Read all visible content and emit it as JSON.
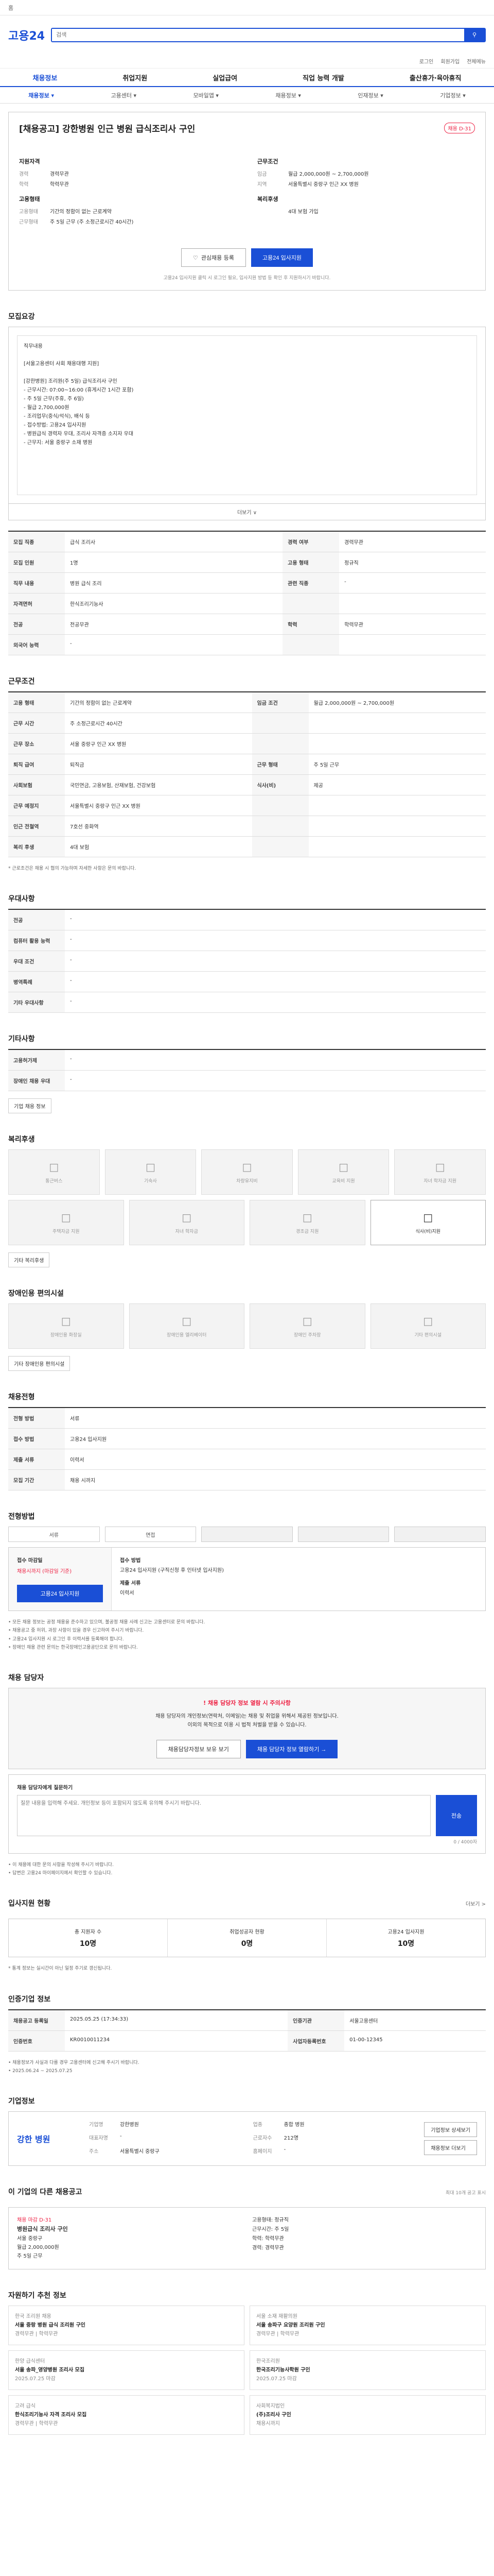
{
  "topbar": {
    "home": "홈"
  },
  "header": {
    "logo": "고용24",
    "search_placeholder": "검색"
  },
  "util": [
    "로그인",
    "회원가입",
    "전체메뉴"
  ],
  "gnb": [
    "채용정보",
    "취업지원",
    "실업급여",
    "직업 능력 개발",
    "출산휴가·육아휴직"
  ],
  "subnav": [
    "채용정보 ▾",
    "고용센터 ▾",
    "모바일앱 ▾",
    "채용정보 ▾",
    "인재정보 ▾",
    "기업정보 ▾"
  ],
  "job": {
    "title": "[채용공고] 강한병원 인근 병원 급식조리사 구인",
    "badge": "채용 D-31",
    "org_head": "지원자격",
    "org_rows": [
      [
        "경력",
        "경력무관"
      ],
      [
        "학력",
        "학력무관"
      ]
    ],
    "cond_head": "근무조건",
    "cond_rows": [
      [
        "임금",
        "월급 2,000,000원 ~ 2,700,000원"
      ],
      [
        "지역",
        "서울특별시 중랑구 인근 XX 병원"
      ]
    ],
    "work_head": "고용형태",
    "work_rows": [
      [
        "고용형태",
        "기간의 정함이 없는 근로계약"
      ],
      [
        "근무형태",
        "주 5일 근무 (주 소정근로시간 40시간)"
      ]
    ],
    "extra_head": "복리후생",
    "extra_rows": [
      [
        "",
        "4대 보험 가입"
      ]
    ],
    "fav": "관심채용 등록",
    "apply": "고용24 입사지원",
    "note": "고용24 입사지원 클릭 시 로그인 필요, 입사지원 방법 등 확인 후 지원하시기 바랍니다."
  },
  "desc": {
    "title": "모집요강",
    "text": "직무내용\n\n[서울고용센터 사회 채용대행 지원]\n\n[강한병원] 조리원(주 5일) 급식조리사 구인\n- 근무시간: 07:00~16:00 (휴게시간 1시간 포함)\n- 주 5일 근무(주휴, 주 6일)\n- 월급 2,700,000원\n- 조리업무(중식/석식), 배식 등\n- 접수방법: 고용24 입사지원\n- 병원급식 경력자 우대, 조리사 자격증 소지자 우대\n- 근무지: 서울 중랑구 소재 병원",
    "more": "더보기 ∨"
  },
  "summary_table": [
    [
      "모집 직종",
      "급식 조리사",
      "경력 여부",
      "경력무관"
    ],
    [
      "모집 인원",
      "1명",
      "고용 형태",
      "정규직"
    ],
    [
      "직무 내용",
      "병원 급식 조리",
      "관련 직종",
      "-"
    ],
    [
      "자격면허",
      "한식조리기능사",
      "",
      ""
    ],
    [
      "전공",
      "전공무관",
      "학력",
      "학력무관"
    ],
    [
      "외국어 능력",
      "-",
      "",
      ""
    ]
  ],
  "cond": {
    "title": "근무조건",
    "rows": [
      [
        "고용 형태",
        "기간의 정함이 없는 근로계약",
        "임금 조건",
        "월급 2,000,000원 ~ 2,700,000원"
      ],
      [
        "근무 시간",
        "주 소정근로시간 40시간",
        "",
        ""
      ],
      [
        "근무 장소",
        "서울 중랑구 인근 XX 병원",
        "",
        ""
      ],
      [
        "퇴직 급여",
        "퇴직금",
        "근무 형태",
        "주 5일 근무"
      ],
      [
        "사회보험",
        "국민연금, 고용보험, 산재보험, 건강보험",
        "식사(비)",
        "제공"
      ],
      [
        "근무 예정지",
        "서울특별시 중랑구 인근 XX 병원",
        "",
        ""
      ],
      [
        "인근 전철역",
        "7호선 중화역",
        "",
        ""
      ],
      [
        "복리 후생",
        "4대 보험",
        "",
        ""
      ]
    ],
    "note": "* 근로조건은 채용 시 협의 가능하며 자세한 사항은 문의 바랍니다."
  },
  "pref": {
    "title": "우대사항",
    "rows": [
      [
        "전공",
        "-"
      ],
      [
        "컴퓨터 활용 능력",
        "-"
      ],
      [
        "우대 조건",
        "-"
      ],
      [
        "병역특례",
        "-"
      ],
      [
        "기타 우대사항",
        "-"
      ]
    ]
  },
  "etc": {
    "title": "기타사항",
    "rows": [
      [
        "고용허가제",
        "-"
      ],
      [
        "장애인 채용 우대",
        "-"
      ]
    ],
    "tag": "기업 채용 정보"
  },
  "welfare": {
    "title": "복리후생",
    "items": [
      "통근버스",
      "기숙사",
      "차량유지비",
      "교육비 지원",
      "자녀 학자금 지원",
      "주택자금 지원",
      "자녀 학자금",
      "경조금 지원",
      "식사(비)지원"
    ],
    "tag": "기타 복리후생"
  },
  "disabled": {
    "title": "장애인용 편의시설",
    "items": [
      "장애인용 화장실",
      "장애인용 엘리베이터",
      "장애인 주차장",
      "기타 편의시설"
    ],
    "tag": "기타 장애인용 편의시설"
  },
  "apply": {
    "title": "채용전형",
    "rows": [
      [
        "전형 방법",
        "서류"
      ],
      [
        "접수 방법",
        "고용24 입사지원"
      ],
      [
        "제출 서류",
        "이력서"
      ],
      [
        "모집 기간",
        "채용 시까지"
      ]
    ],
    "stage_title": "전형방법",
    "stages": [
      "서류",
      "면접",
      "",
      "",
      ""
    ],
    "left_head": "접수 마감일",
    "left_date": "채용시까지 (마감일 기준)",
    "left_btn": "고용24 입사지원",
    "right": [
      "접수 방법",
      "고용24 입사지원 (구직신청 후 인터넷 입사지원)",
      "제출 서류",
      "이력서"
    ],
    "bullets": [
      "• 모든 채용 정보는 공정 채용을 준수하고 있으며, 불공정 채용 사례 신고는 고용센터로 문의 바랍니다.",
      "• 채용공고 중 허위, 과장 사항이 있을 경우 신고하여 주시기 바랍니다.",
      "• 고용24 입사지원 시 로그인 후 이력서를 등록해야 합니다.",
      "• 장애인 채용 관련 문의는 한국장애인고용공단으로 문의 바랍니다."
    ]
  },
  "inquiry": {
    "title": "채용 담당자",
    "warn_head": "! 채용 담당자 정보 열람 시 주의사항",
    "warn_text": "채용 담당자의 개인정보(연락처, 이메일)는 채용 및 취업을 위해서 제공된 정보입니다.\n이외의 목적으로 이용 시 법적 처벌을 받을 수 있습니다.",
    "btn1": "채용담당자정보 보유 보기",
    "btn2": "채용 담당자 정보 열람하기 →",
    "q_head": "채용 담당자에게 질문하기",
    "q_placeholder": "질문 내용을 입력해 주세요. 개인정보 등이 포함되지 않도록 유의해 주시기 바랍니다.",
    "q_count": "0 / 4000자",
    "q_send": "전송",
    "q_notes": [
      "• 이 채용에 대한 문의 사항을 작성해 주시기 바랍니다.",
      "• 답변은 고용24 마이페이지에서 확인할 수 있습니다."
    ]
  },
  "stats": {
    "title": "입사지원 현황",
    "more": "더보기 >",
    "items": [
      [
        "총 지원자 수",
        "10명"
      ],
      [
        "취업성공자 현황",
        "0명"
      ],
      [
        "고용24 입사지원",
        "10명"
      ]
    ],
    "note": "* 통계 정보는 실시간이 아닌 일정 주기로 갱신됩니다."
  },
  "manage": {
    "title": "인증기업 정보",
    "rows": [
      [
        "채용공고 등록일",
        "2025.05.25 (17:34:33)",
        "인증기관",
        "서울고용센터"
      ],
      [
        "인증번호",
        "KR0010011234",
        "사업자등록번호",
        "01-00-12345"
      ]
    ],
    "notes": [
      "• 채용정보가 사실과 다를 경우 고용센터에 신고해 주시기 바랍니다.",
      "• 2025.06.24 ~ 2025.07.25"
    ]
  },
  "company": {
    "title": "기업정보",
    "logo": "강한 병원",
    "rows": [
      [
        "기업명",
        "강한병원"
      ],
      [
        "업종",
        "종합 병원"
      ],
      [
        "대표자명",
        "-"
      ],
      [
        "근로자수",
        "212명"
      ],
      [
        "주소",
        "서울특별시 중랑구"
      ],
      [
        "홈페이지",
        "-"
      ]
    ],
    "btn1": "기업정보 상세보기",
    "btn2": "채용정보 더보기"
  },
  "recommend": {
    "title": "이 기업의 다른 채용공고",
    "more": "최대 10개 공고 표시",
    "left": [
      "채용 마감 D-31",
      "병원급식 조리사 구인",
      "서울 중랑구",
      "월급 2,000,000원",
      "주 5일 근무"
    ],
    "right": [
      "고용형태: 정규직",
      "근무시간: 주 5일",
      "학력: 학력무관",
      "경력: 경력무관"
    ]
  },
  "similar": {
    "title": "자원하기 추천 정보",
    "cards": [
      [
        "한국 조리원 채용",
        "서울 중랑 병원 급식 조리원 구인",
        "경력무관 | 학력무관"
      ],
      [
        "서울 소재 재활의원",
        "서울 송파구 요양원 조리원 구인",
        "경력무관 | 학력무관"
      ],
      [
        "한양 급식센터",
        "서울 송파_영양병원 조리사 모집",
        "2025.07.25 마감"
      ],
      [
        "한국조리원",
        "한국조리기능사학원 구인",
        "2025.07.25 마감"
      ],
      [
        "고려 급식",
        "한식조리기능사 자격 조리사 모집",
        "경력무관 | 학력무관"
      ],
      [
        "사회복지법인",
        "(주)조리사 구인",
        "채용시까지"
      ]
    ]
  }
}
